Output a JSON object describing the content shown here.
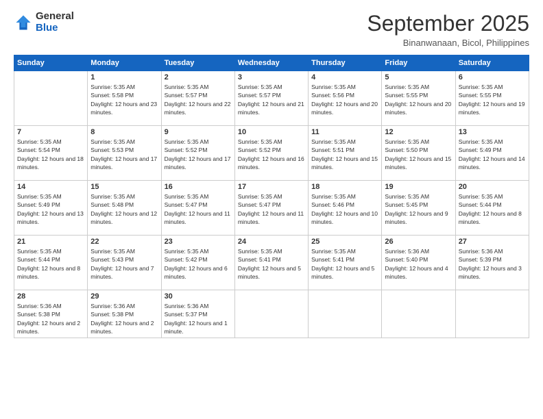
{
  "logo": {
    "general": "General",
    "blue": "Blue"
  },
  "header": {
    "month_year": "September 2025",
    "location": "Binanwanaan, Bicol, Philippines"
  },
  "weekdays": [
    "Sunday",
    "Monday",
    "Tuesday",
    "Wednesday",
    "Thursday",
    "Friday",
    "Saturday"
  ],
  "weeks": [
    [
      {
        "num": "",
        "sunrise": "",
        "sunset": "",
        "daylight": ""
      },
      {
        "num": "1",
        "sunrise": "Sunrise: 5:35 AM",
        "sunset": "Sunset: 5:58 PM",
        "daylight": "Daylight: 12 hours and 23 minutes."
      },
      {
        "num": "2",
        "sunrise": "Sunrise: 5:35 AM",
        "sunset": "Sunset: 5:57 PM",
        "daylight": "Daylight: 12 hours and 22 minutes."
      },
      {
        "num": "3",
        "sunrise": "Sunrise: 5:35 AM",
        "sunset": "Sunset: 5:57 PM",
        "daylight": "Daylight: 12 hours and 21 minutes."
      },
      {
        "num": "4",
        "sunrise": "Sunrise: 5:35 AM",
        "sunset": "Sunset: 5:56 PM",
        "daylight": "Daylight: 12 hours and 20 minutes."
      },
      {
        "num": "5",
        "sunrise": "Sunrise: 5:35 AM",
        "sunset": "Sunset: 5:55 PM",
        "daylight": "Daylight: 12 hours and 20 minutes."
      },
      {
        "num": "6",
        "sunrise": "Sunrise: 5:35 AM",
        "sunset": "Sunset: 5:55 PM",
        "daylight": "Daylight: 12 hours and 19 minutes."
      }
    ],
    [
      {
        "num": "7",
        "sunrise": "Sunrise: 5:35 AM",
        "sunset": "Sunset: 5:54 PM",
        "daylight": "Daylight: 12 hours and 18 minutes."
      },
      {
        "num": "8",
        "sunrise": "Sunrise: 5:35 AM",
        "sunset": "Sunset: 5:53 PM",
        "daylight": "Daylight: 12 hours and 17 minutes."
      },
      {
        "num": "9",
        "sunrise": "Sunrise: 5:35 AM",
        "sunset": "Sunset: 5:52 PM",
        "daylight": "Daylight: 12 hours and 17 minutes."
      },
      {
        "num": "10",
        "sunrise": "Sunrise: 5:35 AM",
        "sunset": "Sunset: 5:52 PM",
        "daylight": "Daylight: 12 hours and 16 minutes."
      },
      {
        "num": "11",
        "sunrise": "Sunrise: 5:35 AM",
        "sunset": "Sunset: 5:51 PM",
        "daylight": "Daylight: 12 hours and 15 minutes."
      },
      {
        "num": "12",
        "sunrise": "Sunrise: 5:35 AM",
        "sunset": "Sunset: 5:50 PM",
        "daylight": "Daylight: 12 hours and 15 minutes."
      },
      {
        "num": "13",
        "sunrise": "Sunrise: 5:35 AM",
        "sunset": "Sunset: 5:49 PM",
        "daylight": "Daylight: 12 hours and 14 minutes."
      }
    ],
    [
      {
        "num": "14",
        "sunrise": "Sunrise: 5:35 AM",
        "sunset": "Sunset: 5:49 PM",
        "daylight": "Daylight: 12 hours and 13 minutes."
      },
      {
        "num": "15",
        "sunrise": "Sunrise: 5:35 AM",
        "sunset": "Sunset: 5:48 PM",
        "daylight": "Daylight: 12 hours and 12 minutes."
      },
      {
        "num": "16",
        "sunrise": "Sunrise: 5:35 AM",
        "sunset": "Sunset: 5:47 PM",
        "daylight": "Daylight: 12 hours and 11 minutes."
      },
      {
        "num": "17",
        "sunrise": "Sunrise: 5:35 AM",
        "sunset": "Sunset: 5:47 PM",
        "daylight": "Daylight: 12 hours and 11 minutes."
      },
      {
        "num": "18",
        "sunrise": "Sunrise: 5:35 AM",
        "sunset": "Sunset: 5:46 PM",
        "daylight": "Daylight: 12 hours and 10 minutes."
      },
      {
        "num": "19",
        "sunrise": "Sunrise: 5:35 AM",
        "sunset": "Sunset: 5:45 PM",
        "daylight": "Daylight: 12 hours and 9 minutes."
      },
      {
        "num": "20",
        "sunrise": "Sunrise: 5:35 AM",
        "sunset": "Sunset: 5:44 PM",
        "daylight": "Daylight: 12 hours and 8 minutes."
      }
    ],
    [
      {
        "num": "21",
        "sunrise": "Sunrise: 5:35 AM",
        "sunset": "Sunset: 5:44 PM",
        "daylight": "Daylight: 12 hours and 8 minutes."
      },
      {
        "num": "22",
        "sunrise": "Sunrise: 5:35 AM",
        "sunset": "Sunset: 5:43 PM",
        "daylight": "Daylight: 12 hours and 7 minutes."
      },
      {
        "num": "23",
        "sunrise": "Sunrise: 5:35 AM",
        "sunset": "Sunset: 5:42 PM",
        "daylight": "Daylight: 12 hours and 6 minutes."
      },
      {
        "num": "24",
        "sunrise": "Sunrise: 5:35 AM",
        "sunset": "Sunset: 5:41 PM",
        "daylight": "Daylight: 12 hours and 5 minutes."
      },
      {
        "num": "25",
        "sunrise": "Sunrise: 5:35 AM",
        "sunset": "Sunset: 5:41 PM",
        "daylight": "Daylight: 12 hours and 5 minutes."
      },
      {
        "num": "26",
        "sunrise": "Sunrise: 5:36 AM",
        "sunset": "Sunset: 5:40 PM",
        "daylight": "Daylight: 12 hours and 4 minutes."
      },
      {
        "num": "27",
        "sunrise": "Sunrise: 5:36 AM",
        "sunset": "Sunset: 5:39 PM",
        "daylight": "Daylight: 12 hours and 3 minutes."
      }
    ],
    [
      {
        "num": "28",
        "sunrise": "Sunrise: 5:36 AM",
        "sunset": "Sunset: 5:38 PM",
        "daylight": "Daylight: 12 hours and 2 minutes."
      },
      {
        "num": "29",
        "sunrise": "Sunrise: 5:36 AM",
        "sunset": "Sunset: 5:38 PM",
        "daylight": "Daylight: 12 hours and 2 minutes."
      },
      {
        "num": "30",
        "sunrise": "Sunrise: 5:36 AM",
        "sunset": "Sunset: 5:37 PM",
        "daylight": "Daylight: 12 hours and 1 minute."
      },
      {
        "num": "",
        "sunrise": "",
        "sunset": "",
        "daylight": ""
      },
      {
        "num": "",
        "sunrise": "",
        "sunset": "",
        "daylight": ""
      },
      {
        "num": "",
        "sunrise": "",
        "sunset": "",
        "daylight": ""
      },
      {
        "num": "",
        "sunrise": "",
        "sunset": "",
        "daylight": ""
      }
    ]
  ]
}
